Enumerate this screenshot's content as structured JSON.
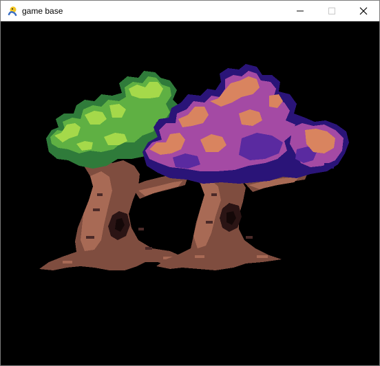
{
  "window": {
    "title": "game base",
    "app_icon": "pygame-snake-icon",
    "controls": [
      "minimize-icon",
      "maximize-icon",
      "close-icon"
    ]
  },
  "scene": {
    "background_color": "#000000",
    "sprite": "twin-trees",
    "palette": {
      "trunk_light": "#a86a55",
      "trunk_mid": "#7f4d3f",
      "trunk_dark": "#4b2a28",
      "green_light": "#a5d94a",
      "green_mid": "#5fb043",
      "green_dark": "#2f7b3a",
      "peach": "#d9845f",
      "magenta": "#a44aa4",
      "violet": "#5a2aa0",
      "deep_violet": "#2a1478"
    }
  }
}
